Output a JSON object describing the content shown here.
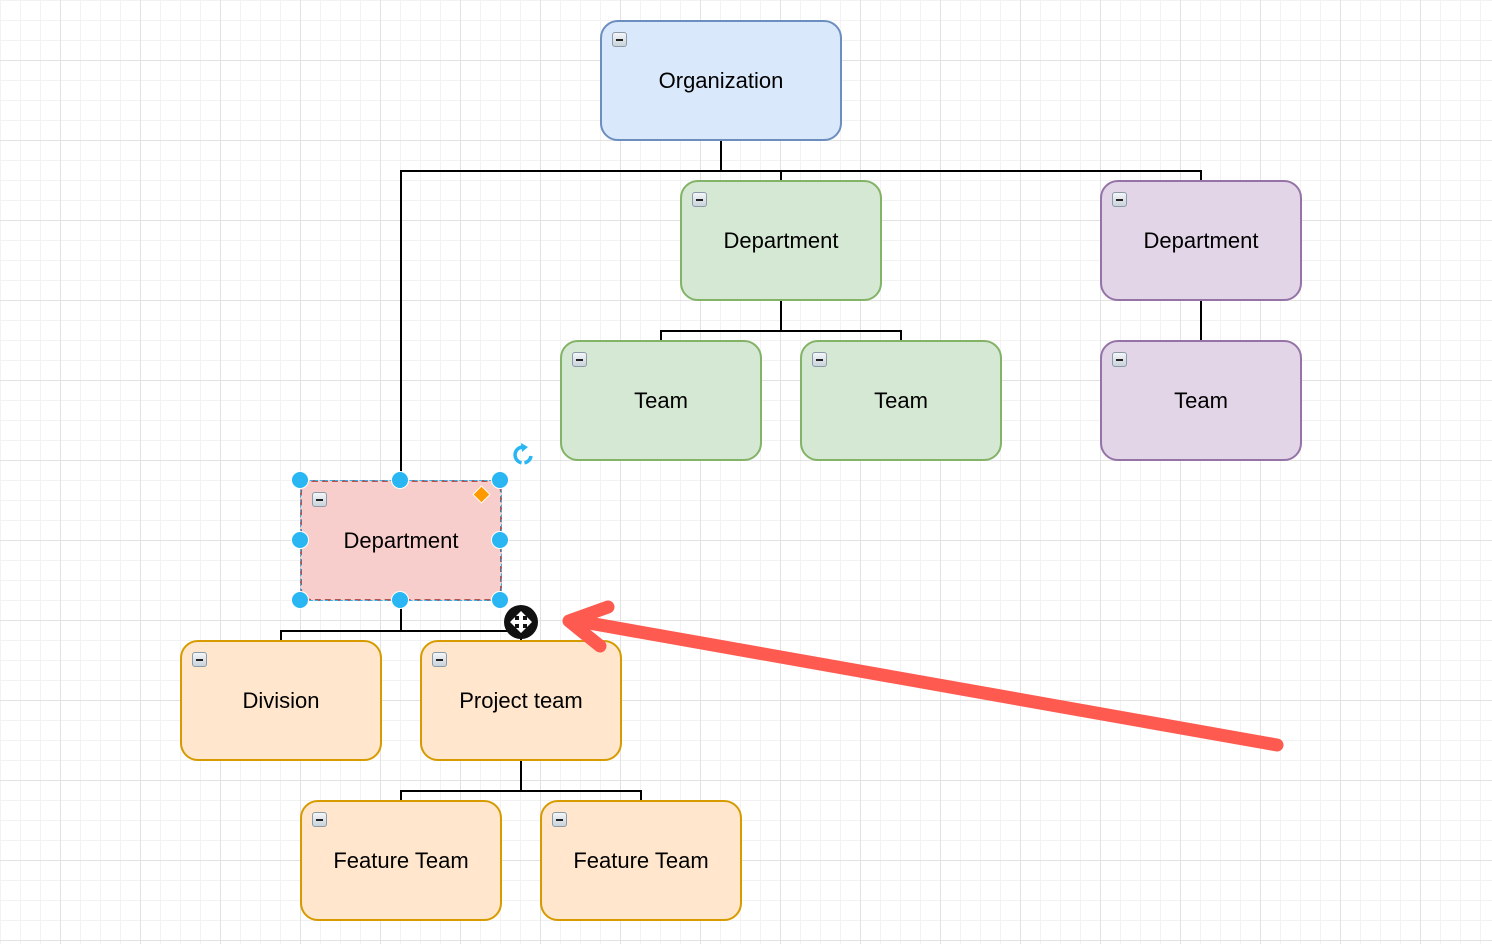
{
  "diagram": {
    "type": "org-chart",
    "colors": {
      "blue_fill": "#dae8fc",
      "blue_stroke": "#6c8ebf",
      "green_fill": "#d5e8d4",
      "green_stroke": "#82b366",
      "purple_fill": "#e1d5e7",
      "purple_stroke": "#9673a6",
      "red_fill": "#f8cecc",
      "red_stroke": "#b85450",
      "orange_fill": "#ffe6cc",
      "orange_stroke": "#d79b00",
      "selection": "#29b6f2",
      "annotation_arrow": "#ff5a4f",
      "connector": "#000000"
    },
    "nodes": [
      {
        "id": "org",
        "label": "Organization",
        "color": "blue",
        "parent": null
      },
      {
        "id": "dept-green",
        "label": "Department",
        "color": "green",
        "parent": "org"
      },
      {
        "id": "dept-purple",
        "label": "Department",
        "color": "purple",
        "parent": "org"
      },
      {
        "id": "team-green-1",
        "label": "Team",
        "color": "green",
        "parent": "dept-green"
      },
      {
        "id": "team-green-2",
        "label": "Team",
        "color": "green",
        "parent": "dept-green"
      },
      {
        "id": "team-purple",
        "label": "Team",
        "color": "purple",
        "parent": "dept-purple"
      },
      {
        "id": "dept-red",
        "label": "Department",
        "color": "red",
        "parent": "org",
        "selected": true
      },
      {
        "id": "division",
        "label": "Division",
        "color": "orange",
        "parent": "dept-red"
      },
      {
        "id": "project-team",
        "label": "Project team",
        "color": "orange",
        "parent": "dept-red"
      },
      {
        "id": "feature-team-1",
        "label": "Feature Team",
        "color": "orange",
        "parent": "project-team"
      },
      {
        "id": "feature-team-2",
        "label": "Feature Team",
        "color": "orange",
        "parent": "project-team"
      }
    ],
    "icons": {
      "collapse": "collapse-minus-icon",
      "rotate": "rotate-icon",
      "move": "move-arrows-icon",
      "resize": "resize-handle",
      "shape_adjust": "diamond-adjust-handle",
      "annotation": "red-arrow-annotation"
    }
  }
}
